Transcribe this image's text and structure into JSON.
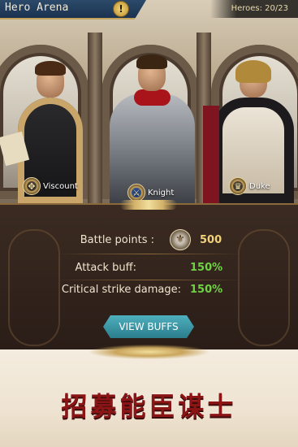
{
  "header": {
    "title": "Hero Arena",
    "info_icon": "!",
    "heroes_label": "Heroes:",
    "heroes_count": "20/23"
  },
  "heroes": [
    {
      "name": "Viscount",
      "icon": "crest-icon"
    },
    {
      "name": "Knight",
      "icon": "shield-icon"
    },
    {
      "name": "Duke",
      "icon": "crown-icon"
    }
  ],
  "stats": {
    "battle_points_label": "Battle points :",
    "battle_points_value": "500",
    "attack_buff_label": "Attack buff:",
    "attack_buff_value": "150%",
    "crit_label": "Critical strike damage:",
    "crit_value": "150%"
  },
  "buttons": {
    "view_buffs": "VIEW BUFFS"
  },
  "slogan": "招募能臣谋士",
  "colors": {
    "accent_gold": "#c9a55c",
    "value_green": "#6fd245",
    "button_teal": "#3b97a6",
    "slogan_red": "#8b1414"
  }
}
